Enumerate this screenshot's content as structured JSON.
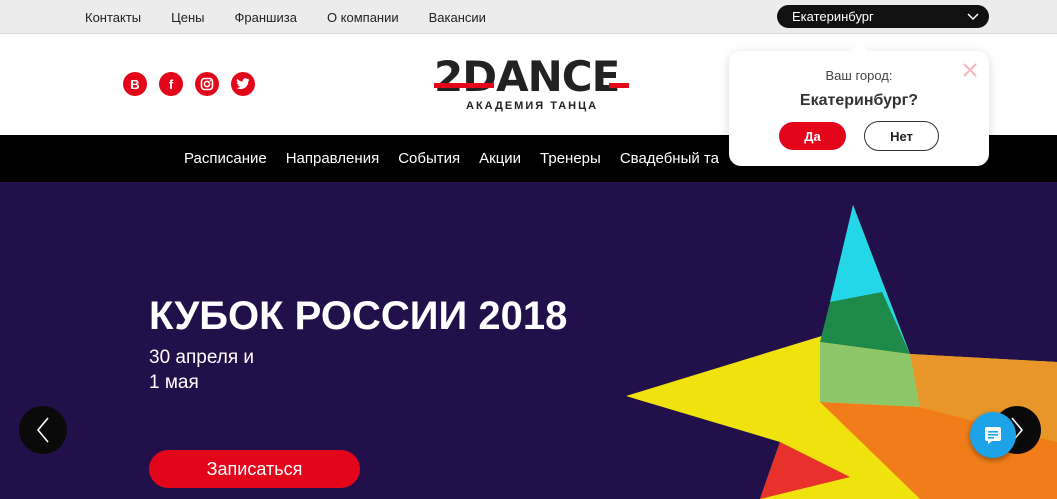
{
  "topbar": {
    "links": [
      "Контакты",
      "Цены",
      "Франшиза",
      "О компании",
      "Вакансии"
    ],
    "city": "Екатеринбург"
  },
  "header": {
    "social": [
      {
        "icon": "vk-icon",
        "glyph": "В"
      },
      {
        "icon": "facebook-icon",
        "glyph": "f"
      },
      {
        "icon": "instagram-icon",
        "glyph": ""
      },
      {
        "icon": "twitter-icon",
        "glyph": ""
      }
    ],
    "logo_main": "2DANCE",
    "logo_sub": "АКАДЕМИЯ ТАНЦА"
  },
  "nav": {
    "items": [
      "Расписание",
      "Направления",
      "События",
      "Акции",
      "Тренеры",
      "Свадебный та"
    ]
  },
  "hero": {
    "title": "КУБОК РОССИИ 2018",
    "date": "30 апреля и\n1 мая",
    "cta": "Записаться"
  },
  "city_popup": {
    "question": "Ваш город:",
    "city": "Екатеринбург?",
    "yes": "Да",
    "no": "Нет"
  },
  "colors": {
    "accent": "#e3061b",
    "hero_bg": "#22104a",
    "chat": "#1fa3e8"
  }
}
